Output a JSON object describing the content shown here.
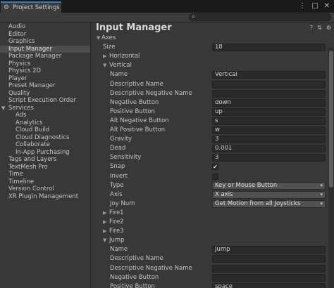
{
  "window": {
    "tab_title": "Project Settings",
    "tab_icon": "gear-icon",
    "controls": [
      "⋮",
      "□",
      "✕"
    ]
  },
  "search": {
    "value": "",
    "placeholder": ""
  },
  "sidebar": {
    "items": [
      {
        "label": "Audio"
      },
      {
        "label": "Editor"
      },
      {
        "label": "Graphics"
      },
      {
        "label": "Input Manager",
        "selected": true
      },
      {
        "label": "Package Manager"
      },
      {
        "label": "Physics"
      },
      {
        "label": "Physics 2D"
      },
      {
        "label": "Player"
      },
      {
        "label": "Preset Manager"
      },
      {
        "label": "Quality"
      },
      {
        "label": "Script Execution Order"
      },
      {
        "label": "Services",
        "expanded": true
      },
      {
        "label": "Ads",
        "child": true
      },
      {
        "label": "Analytics",
        "child": true
      },
      {
        "label": "Cloud Build",
        "child": true
      },
      {
        "label": "Cloud Diagnostics",
        "child": true
      },
      {
        "label": "Collaborate",
        "child": true
      },
      {
        "label": "In-App Purchasing",
        "child": true
      },
      {
        "label": "Tags and Layers"
      },
      {
        "label": "TextMesh Pro"
      },
      {
        "label": "Time"
      },
      {
        "label": "Timeline"
      },
      {
        "label": "Version Control"
      },
      {
        "label": "XR Plugin Management"
      }
    ]
  },
  "main": {
    "title": "Input Manager",
    "header_icons": [
      "?",
      "⇅",
      "⚙"
    ],
    "axes_label": "Axes",
    "size_label": "Size",
    "size_value": "18",
    "horizontal_label": "Horizontal",
    "vertical": {
      "label": "Vertical",
      "fields": [
        {
          "label": "Name",
          "value": "Vertical"
        },
        {
          "label": "Descriptive Name",
          "value": ""
        },
        {
          "label": "Descriptive Negative Name",
          "value": ""
        },
        {
          "label": "Negative Button",
          "value": "down"
        },
        {
          "label": "Positive Button",
          "value": "up"
        },
        {
          "label": "Alt Negative Button",
          "value": "s"
        },
        {
          "label": "Alt Positive Button",
          "value": "w"
        },
        {
          "label": "Gravity",
          "value": "3"
        },
        {
          "label": "Dead",
          "value": "0.001"
        },
        {
          "label": "Sensitivity",
          "value": "3"
        }
      ],
      "snap_label": "Snap",
      "snap_checked": true,
      "invert_label": "Invert",
      "invert_checked": false,
      "type_label": "Type",
      "type_value": "Key or Mouse Button",
      "axis_label": "Axis",
      "axis_value": "X axis",
      "joy_label": "Joy Num",
      "joy_value": "Get Motion from all Joysticks"
    },
    "fire1": "Fire1",
    "fire2": "Fire2",
    "fire3": "Fire3",
    "jump": {
      "label": "Jump",
      "fields": [
        {
          "label": "Name",
          "value": "Jump"
        },
        {
          "label": "Descriptive Name",
          "value": ""
        },
        {
          "label": "Descriptive Negative Name",
          "value": ""
        },
        {
          "label": "Negative Button",
          "value": ""
        },
        {
          "label": "Positive Button",
          "value": "space"
        }
      ]
    }
  },
  "colors": {
    "background": "#383838",
    "field": "#2a2a2a",
    "selection": "#4d4d4d",
    "tab_accent": "#3a79bb"
  }
}
